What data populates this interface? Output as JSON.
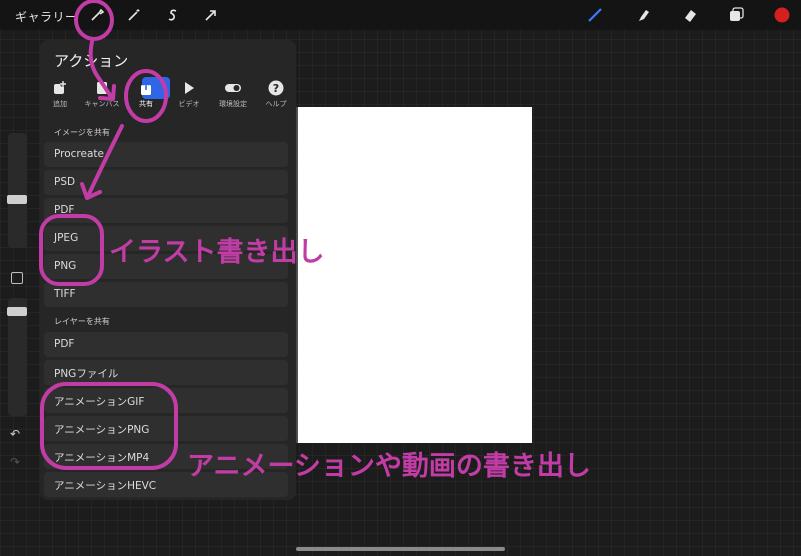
{
  "topbar": {
    "gallery_label": "ギャラリー",
    "left_tools": [
      "wrench-icon",
      "magic-wand-icon",
      "selection-s-icon",
      "arrow-transform-icon"
    ],
    "right_tools": [
      "brush-icon",
      "smudge-icon",
      "eraser-icon",
      "layers-icon"
    ],
    "color_swatch": "#d61f1f"
  },
  "panel": {
    "title": "アクション",
    "tabs": [
      {
        "label": "追加",
        "icon": "add-icon"
      },
      {
        "label": "キャンバス",
        "icon": "canvas-icon"
      },
      {
        "label": "共有",
        "icon": "share-icon",
        "active": true
      },
      {
        "label": "ビデオ",
        "icon": "play-icon"
      },
      {
        "label": "環境設定",
        "icon": "toggle-icon"
      },
      {
        "label": "ヘルプ",
        "icon": "help-icon"
      }
    ],
    "share_image_section": "イメージを共有",
    "share_image_items": [
      "Procreate",
      "PSD",
      "PDF",
      "JPEG",
      "PNG",
      "TIFF"
    ],
    "share_layers_section": "レイヤーを共有",
    "share_layers_items": [
      "PDF",
      "PNGファイル",
      "アニメーションGIF",
      "アニメーションPNG",
      "アニメーションMP4",
      "アニメーションHEVC"
    ]
  },
  "annotations": {
    "illustration_export": "イラスト書き出し",
    "animation_export": "アニメーションや動画の書き出し",
    "color": "#c23ca6"
  }
}
